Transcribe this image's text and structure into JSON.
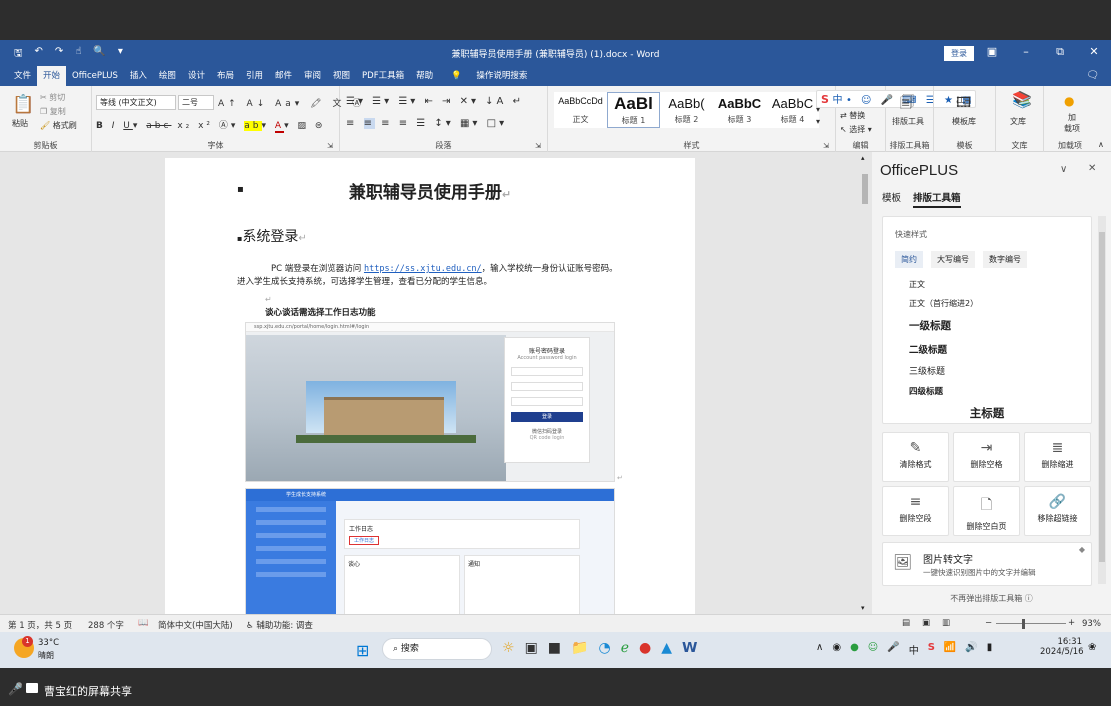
{
  "window": {
    "title": "兼职辅导员使用手册 (兼职辅导员) (1).docx - Word",
    "login_label": "登录"
  },
  "menu": {
    "items": [
      "文件",
      "开始",
      "OfficePLUS",
      "插入",
      "绘图",
      "设计",
      "布局",
      "引用",
      "邮件",
      "审阅",
      "视图",
      "PDF工具箱",
      "帮助"
    ],
    "search_label": "操作说明搜索"
  },
  "ribbon": {
    "clipboard": {
      "paste": "粘贴",
      "cut": "剪切",
      "copy": "复制",
      "painter": "格式刷",
      "label": "剪贴板"
    },
    "font": {
      "name": "等线 (中文正文)",
      "size": "二号",
      "label": "字体"
    },
    "paragraph": {
      "label": "段落"
    },
    "styles": {
      "label": "样式",
      "items": [
        {
          "preview": "AaBbCcDd",
          "name": "正文"
        },
        {
          "preview": "AaBl",
          "name": "标题 1"
        },
        {
          "preview": "AaBb(",
          "name": "标题 2"
        },
        {
          "preview": "AaBbC",
          "name": "标题 3"
        },
        {
          "preview": "AaBbC",
          "name": "标题 4"
        }
      ]
    },
    "editing": {
      "label": "编辑",
      "replace": "替换",
      "select": "选择"
    },
    "tools": {
      "layout_tool": "排版工具",
      "template_lib": "模板库",
      "library": "文库",
      "addin": "加载项",
      "addin_top": "加",
      "addin_bottom": "载项"
    },
    "tools_labels": {
      "layout_box": "排版工具箱",
      "template": "模板",
      "library": "文库",
      "addin": "加载项"
    }
  },
  "document": {
    "title": "兼职辅导员使用手册",
    "heading": "系统登录",
    "para_prefix": "PC 端登录在浏览器访问 ",
    "link": "https://ss.xjtu.edu.cn/",
    "para_suffix": "，输入学校统一身份认证账号密码。进入学生成长支持系统，可选择学生管理，查看已分配的学生信息。",
    "subheading": "谈心谈话需选择工作日志功能",
    "shot1": {
      "address": "ssp.xjtu.edu.cn/portal/home/login.html#/login",
      "login_title": "账号密码登录",
      "login_sub": "Account password login",
      "login_button": "登录",
      "qr": "微信扫码登录",
      "qr_sub": "QR code login"
    },
    "shot2": {
      "app_title": "学生成长支持系统",
      "section": "工作日志",
      "tag": "工作日志",
      "col1": "谈心",
      "col2": "通知"
    }
  },
  "panel": {
    "title": "OfficePLUS",
    "tabs": [
      "模板",
      "排版工具箱"
    ],
    "quick_label": "快速样式",
    "chips": [
      "简约",
      "大写编号",
      "数字编号"
    ],
    "styles": [
      "正文",
      "正文（首行缩进2）",
      "一级标题",
      "二级标题",
      "三级标题",
      "四级标题",
      "主标题"
    ],
    "tools": [
      "清除格式",
      "删除空格",
      "删除缩进",
      "删除空段",
      "删除空白页",
      "移除超链接"
    ],
    "ocr_title": "图片转文字",
    "ocr_desc": "一键快速识别图片中的文字并编辑",
    "footer": "不再弹出排版工具箱"
  },
  "status": {
    "page": "第 1 页，共 5 页",
    "words": "288 个字",
    "lang": "简体中文(中国大陆)",
    "access": "辅助功能: 调查",
    "zoom": "93%"
  },
  "taskbar": {
    "weather_temp": "33°C",
    "weather_desc": "晴朗",
    "weather_badge": "1",
    "search": "搜索",
    "ime": "中",
    "time": "16:31",
    "date": "2024/5/16"
  },
  "share": {
    "label": "曹宝红的屏幕共享"
  },
  "colors": {
    "word_blue": "#2b579a",
    "officeplus_orange": "#f0a000",
    "link_blue": "#1f5fbf"
  }
}
